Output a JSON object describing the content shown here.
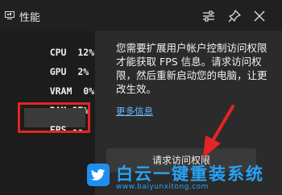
{
  "window": {
    "title": "性能",
    "buttons": [
      "settings-sliders-icon",
      "pin-icon",
      "close-icon"
    ]
  },
  "metrics": [
    {
      "label": "CPU",
      "value": "12%"
    },
    {
      "label": "GPU",
      "value": "2%"
    },
    {
      "label": "VRAM",
      "value": "0%"
    },
    {
      "label": "RAM",
      "value": "87%"
    }
  ],
  "fps": {
    "label": "FPS",
    "value": "--"
  },
  "panel": {
    "message": "您需要扩展用户帐户控制访问权限才能获取 FPS 信息。请求访问权限，然后重新启动您的电脑，让更改生效。",
    "more_link": "更多信息",
    "request_button": "请求访问权限"
  },
  "watermark": {
    "text": "白云一键重装系统",
    "url": "www.baiyunxitong.com"
  },
  "colors": {
    "highlight": "#e52424",
    "link": "#6cb6ff",
    "watermark": "#27a3f5"
  }
}
